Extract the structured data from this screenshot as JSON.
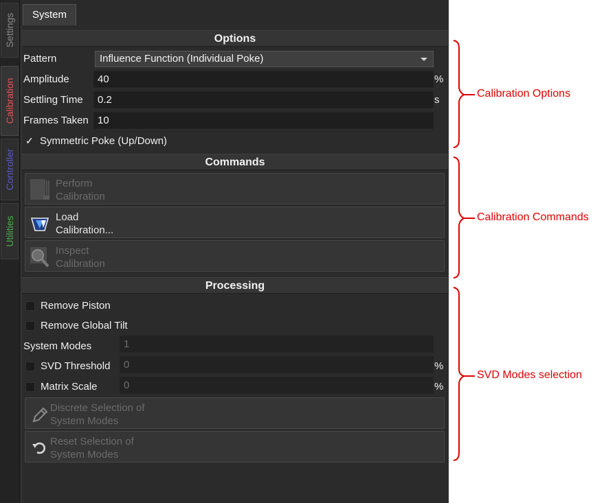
{
  "side_tabs": [
    {
      "label": "Settings",
      "color": "#8a8a8a"
    },
    {
      "label": "Calibration",
      "color": "#e05555"
    },
    {
      "label": "Controller",
      "color": "#5a5acc"
    },
    {
      "label": "Utilities",
      "color": "#4caf50"
    }
  ],
  "top_tab": "System",
  "options": {
    "header": "Options",
    "pattern_label": "Pattern",
    "pattern_value": "Influence Function (Individual Poke)",
    "amplitude_label": "Amplitude",
    "amplitude_value": "40",
    "amplitude_unit": "%",
    "settling_label": "Settling Time",
    "settling_value": "0.2",
    "settling_unit": "s",
    "frames_label": "Frames Taken",
    "frames_value": "10",
    "symmetric_check": "✓",
    "symmetric_label": "Symmetric Poke (Up/Down)"
  },
  "commands": {
    "header": "Commands",
    "perform_line1": "Perform",
    "perform_line2": "Calibration",
    "load_line1": "Load",
    "load_line2": "Calibration...",
    "inspect_line1": "Inspect",
    "inspect_line2": "Calibration"
  },
  "processing": {
    "header": "Processing",
    "remove_piston": "Remove Piston",
    "remove_tilt": "Remove Global Tilt",
    "system_modes_label": "System Modes",
    "system_modes_value": "1",
    "svd_label": "SVD Threshold",
    "svd_value": "0",
    "svd_unit": "%",
    "matrix_label": "Matrix Scale",
    "matrix_value": "0",
    "matrix_unit": "%",
    "discrete_line1": "Discrete Selection of",
    "discrete_line2": "System Modes",
    "reset_line1": "Reset Selection of",
    "reset_line2": "System Modes"
  },
  "annotations": {
    "calibration_options": "Calibration Options",
    "calibration_commands": "Calibration Commands",
    "svd_modes": "SVD Modes selection",
    "color": "#e00000"
  }
}
